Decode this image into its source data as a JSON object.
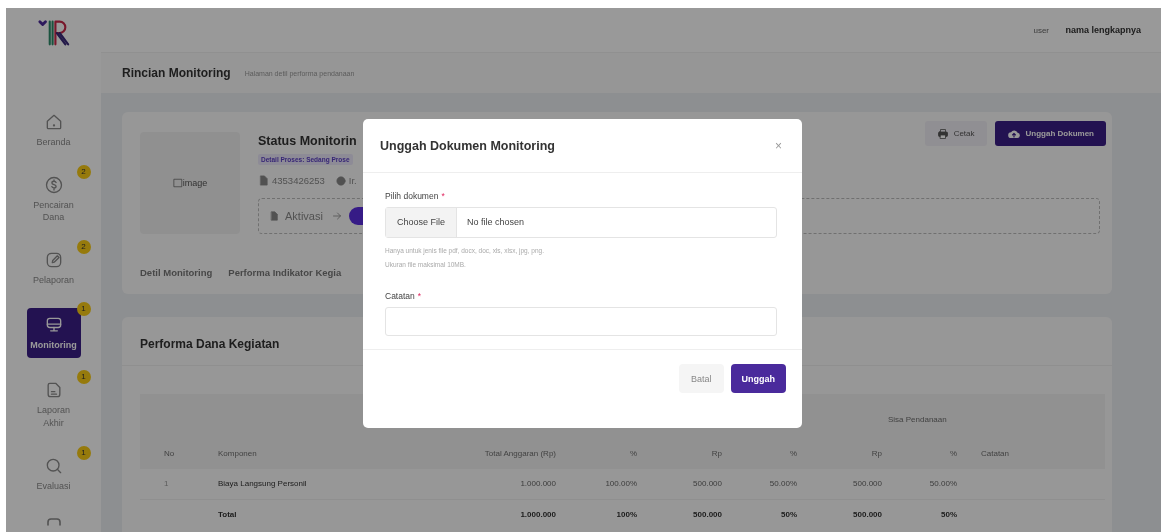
{
  "header": {
    "avatar_alt": "user",
    "user_name": "nama lengkapnya"
  },
  "page": {
    "title": "Rincian Monitoring",
    "subtitle": "Halaman detil performa pendanaan"
  },
  "sidebar": {
    "items": [
      {
        "label": "Beranda",
        "selected": false
      },
      {
        "label": "Pencairan Dana",
        "badge": "2",
        "selected": false
      },
      {
        "label": "Pelaporan",
        "badge": "2",
        "selected": false
      },
      {
        "label": "Monitoring",
        "badge": "1",
        "selected": true
      },
      {
        "label": "Laporan Akhir",
        "badge": "1",
        "selected": false
      },
      {
        "label": "Evaluasi",
        "badge": "1",
        "selected": false
      }
    ]
  },
  "summary": {
    "image_alt": "image",
    "title": "Status Monitorin",
    "process_badge": "Detail Proses: Sedang Prose",
    "number": "4353426253",
    "person": "Ir.",
    "step": "Aktivasi",
    "actions": [
      {
        "label": "Cetak",
        "kind": "print"
      },
      {
        "label": "Unggah Dokumen",
        "kind": "upload"
      }
    ]
  },
  "tabs": [
    {
      "label": "Detil Monitoring",
      "selected": false
    },
    {
      "label": "Performa Indikator Kegia",
      "selected": false
    }
  ],
  "table_card": {
    "title": "Performa Dana Kegiatan",
    "group_header": "Sisa Pendanaan",
    "columns": [
      "No",
      "Komponen",
      "Total Anggaran (Rp)",
      "%",
      "Rp",
      "%",
      "Rp",
      "%",
      "Catatan"
    ],
    "rows": [
      [
        "1",
        "Biaya Langsung Personil",
        "1.000.000",
        "100.00%",
        "500.000",
        "50.00%",
        "500.000",
        "50.00%",
        null
      ]
    ],
    "total": {
      "label": "Total",
      "values": [
        "1.000.000",
        "100%",
        "500.000",
        "50%",
        "500.000",
        "50%"
      ]
    }
  },
  "modal": {
    "title": "Unggah Dokumen Monitoring",
    "close": "×",
    "file_label": "Pilih dokumen",
    "file_button": "Choose File",
    "file_status": "No file chosen",
    "hints": [
      "Hanya untuk jenis file pdf, docx, doc, xls, xlsx, jpg, png.",
      "Ukuran file maksimal 10MB."
    ],
    "note_label": "Catatan",
    "required_mark": "*",
    "buttons": [
      {
        "label": "Batal",
        "kind": "secondary"
      },
      {
        "label": "Unggah",
        "kind": "primary"
      }
    ]
  }
}
